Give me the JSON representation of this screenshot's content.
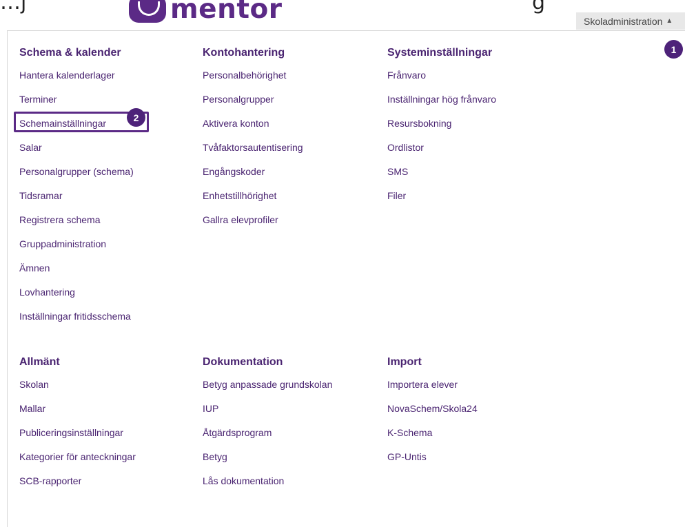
{
  "header": {
    "logo_text": "mentor",
    "top_left_clip": "…j",
    "top_right_clip": "g",
    "dropdown_label": "Skoladministration",
    "dropdown_caret": "▲"
  },
  "badges": {
    "one": "1",
    "two": "2"
  },
  "sections": {
    "schema": {
      "heading": "Schema & kalender",
      "items": [
        "Hantera kalenderlager",
        "Terminer",
        "Schemainställningar",
        "Salar",
        "Personalgrupper (schema)",
        "Tidsramar",
        "Registrera schema",
        "Gruppadministration",
        "Ämnen",
        "Lovhantering",
        "Inställningar fritidsschema"
      ]
    },
    "konto": {
      "heading": "Kontohantering",
      "items": [
        "Personalbehörighet",
        "Personalgrupper",
        "Aktivera konton",
        "Tvåfaktorsautentisering",
        "Engångskoder",
        "Enhetstillhörighet",
        "Gallra elevprofiler"
      ]
    },
    "system": {
      "heading": "Systeminställningar",
      "items": [
        "Frånvaro",
        "Inställningar hög frånvaro",
        "Resursbokning",
        "Ordlistor",
        "SMS",
        "Filer"
      ]
    },
    "allmant": {
      "heading": "Allmänt",
      "items": [
        "Skolan",
        "Mallar",
        "Publiceringsinställningar",
        "Kategorier för anteckningar",
        "SCB-rapporter"
      ]
    },
    "dokumentation": {
      "heading": "Dokumentation",
      "items": [
        "Betyg anpassade grundskolan",
        "IUP",
        "Åtgärdsprogram",
        "Betyg",
        "Lås dokumentation"
      ]
    },
    "import": {
      "heading": "Import",
      "items": [
        "Importera elever",
        "NovaSchem/Skola24",
        "K-Schema",
        "GP-Untis"
      ]
    }
  }
}
